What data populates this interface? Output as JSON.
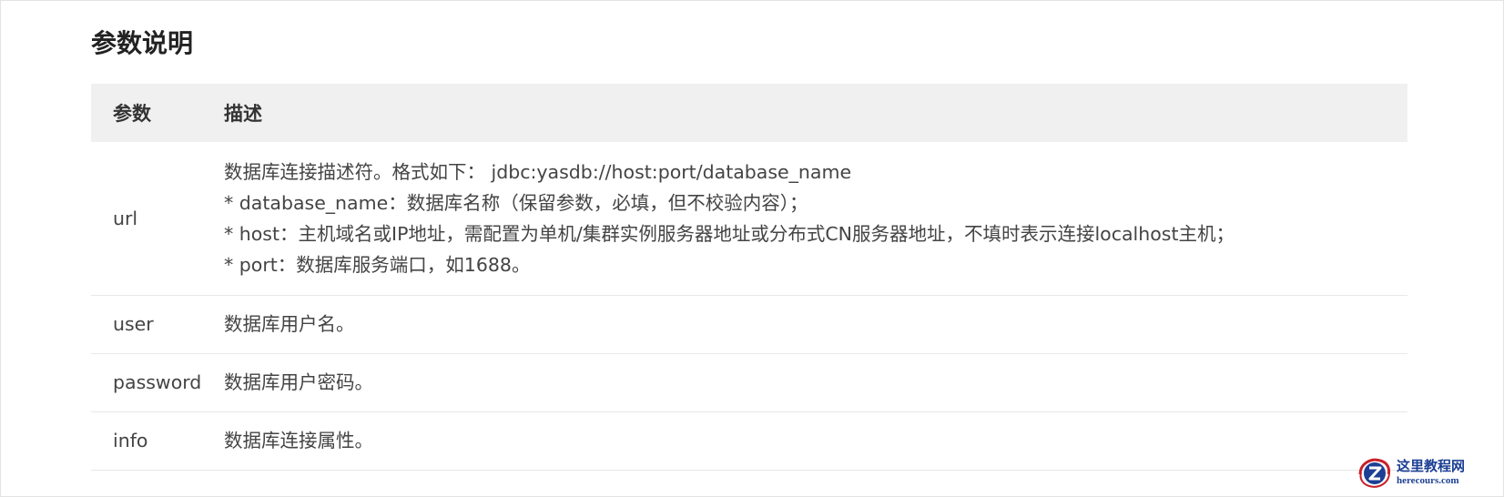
{
  "section": {
    "title": "参数说明"
  },
  "table": {
    "headers": {
      "param": "参数",
      "desc": "描述"
    },
    "rows": [
      {
        "param": "url",
        "lines": [
          "数据库连接描述符。格式如下： jdbc:yasdb://host:port/database_name",
          "* database_name：数据库名称（保留参数，必填，但不校验内容）；",
          "* host：主机域名或IP地址，需配置为单机/集群实例服务器地址或分布式CN服务器地址，不填时表示连接localhost主机；",
          "* port：数据库服务端口，如1688。"
        ]
      },
      {
        "param": "user",
        "lines": [
          "数据库用户名。"
        ]
      },
      {
        "param": "password",
        "lines": [
          "数据库用户密码。"
        ]
      },
      {
        "param": "info",
        "lines": [
          "数据库连接属性。"
        ]
      }
    ]
  },
  "watermark": {
    "name_cn": "这里教程网",
    "domain": "herecours.com",
    "colors": {
      "blue": "#1c3f94",
      "red": "#c8202a"
    }
  }
}
